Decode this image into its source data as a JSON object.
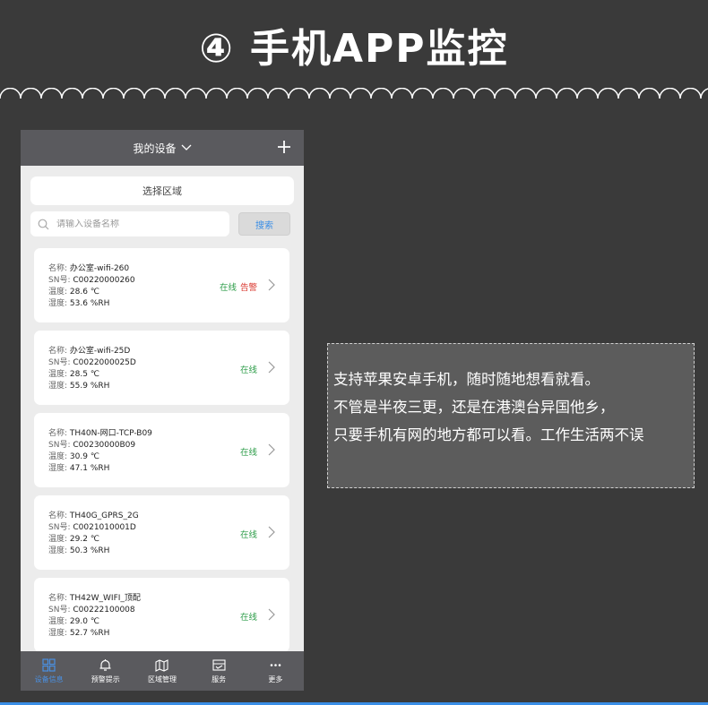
{
  "page_title": "④ 手机APP监控",
  "app": {
    "header_title": "我的设备",
    "select_area_label": "选择区域",
    "search_placeholder": "请输入设备名称",
    "search_button": "搜索",
    "devices": [
      {
        "name_key": "名称:",
        "name": "办公室-wifi-260",
        "sn_key": "SN号:",
        "sn": "C00220000260",
        "temp_key": "温度:",
        "temp": "28.6 ℃",
        "hum_key": "湿度:",
        "hum": "53.6 %RH",
        "status": "在线",
        "alarm": "告警"
      },
      {
        "name_key": "名称:",
        "name": "办公室-wifi-25D",
        "sn_key": "SN号:",
        "sn": "C0022000025D",
        "temp_key": "温度:",
        "temp": "28.5 ℃",
        "hum_key": "湿度:",
        "hum": "55.9 %RH",
        "status": "在线",
        "alarm": ""
      },
      {
        "name_key": "名称:",
        "name": "TH40N-网口-TCP-B09",
        "sn_key": "SN号:",
        "sn": "C00230000B09",
        "temp_key": "温度:",
        "temp": "30.9 ℃",
        "hum_key": "湿度:",
        "hum": "47.1 %RH",
        "status": "在线",
        "alarm": ""
      },
      {
        "name_key": "名称:",
        "name": "TH40G_GPRS_2G",
        "sn_key": "SN号:",
        "sn": "C0021010001D",
        "temp_key": "温度:",
        "temp": "29.2 ℃",
        "hum_key": "湿度:",
        "hum": "50.3 %RH",
        "status": "在线",
        "alarm": ""
      },
      {
        "name_key": "名称:",
        "name": "TH42W_WIFI_顶配",
        "sn_key": "SN号:",
        "sn": "C00222100008",
        "temp_key": "温度:",
        "temp": "29.0 ℃",
        "hum_key": "湿度:",
        "hum": "52.7 %RH",
        "status": "在线",
        "alarm": ""
      }
    ],
    "tabs": [
      {
        "label": "设备信息",
        "icon": "grid-icon",
        "active": true
      },
      {
        "label": "预警提示",
        "icon": "bell-icon",
        "active": false
      },
      {
        "label": "区域管理",
        "icon": "map-icon",
        "active": false
      },
      {
        "label": "服务",
        "icon": "store-icon",
        "active": false
      },
      {
        "label": "更多",
        "icon": "more-icon",
        "active": false
      }
    ]
  },
  "description": [
    "支持苹果安卓手机，随时随地想看就看。",
    "不管是半夜三更，还是在港澳台异国他乡，",
    "只要手机有网的地方都可以看。工作生活两不误"
  ],
  "colors": {
    "online": "#2e9d4a",
    "alarm": "#d9342b",
    "active_tab": "#4a90e2",
    "background": "#3a3a3a"
  }
}
